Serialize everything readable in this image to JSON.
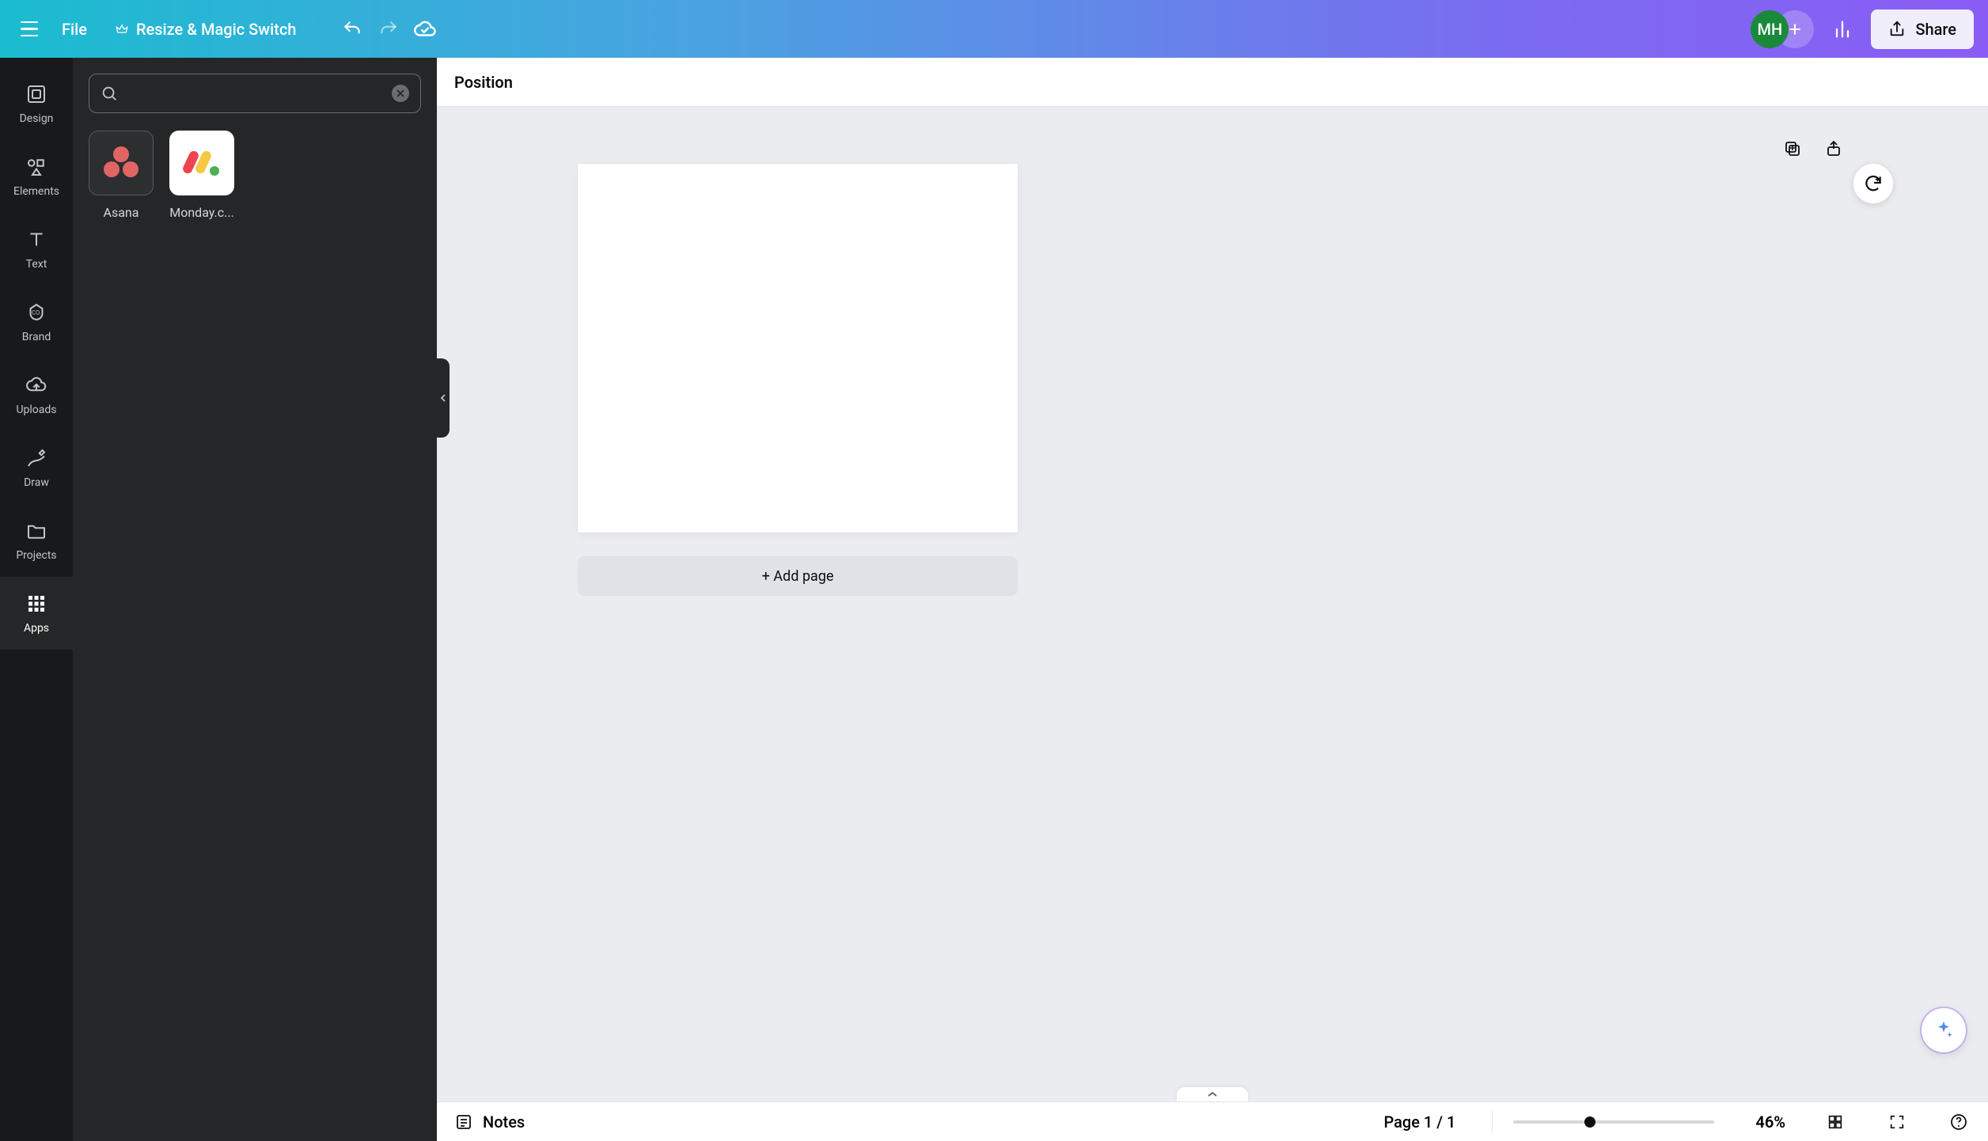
{
  "topbar": {
    "file_label": "File",
    "resize_label": "Resize & Magic Switch",
    "avatar_initials": "MH",
    "share_label": "Share"
  },
  "rail": {
    "items": [
      {
        "id": "design",
        "label": "Design"
      },
      {
        "id": "elements",
        "label": "Elements"
      },
      {
        "id": "text",
        "label": "Text"
      },
      {
        "id": "brand",
        "label": "Brand"
      },
      {
        "id": "uploads",
        "label": "Uploads"
      },
      {
        "id": "draw",
        "label": "Draw"
      },
      {
        "id": "projects",
        "label": "Projects"
      },
      {
        "id": "apps",
        "label": "Apps"
      }
    ],
    "active_id": "apps"
  },
  "panel": {
    "search_value": "",
    "search_placeholder": "",
    "apps": [
      {
        "id": "asana",
        "label": "Asana"
      },
      {
        "id": "monday",
        "label": "Monday.c..."
      }
    ]
  },
  "contextbar": {
    "position_label": "Position"
  },
  "canvas": {
    "add_page_label": "+ Add page"
  },
  "footer": {
    "notes_label": "Notes",
    "page_indicator": "Page 1 / 1",
    "zoom_label": "46%"
  },
  "colors": {
    "accent_teal": "#1bbcd0",
    "accent_purple": "#8a5cf6",
    "avatar_bg": "#1a8a3a"
  }
}
